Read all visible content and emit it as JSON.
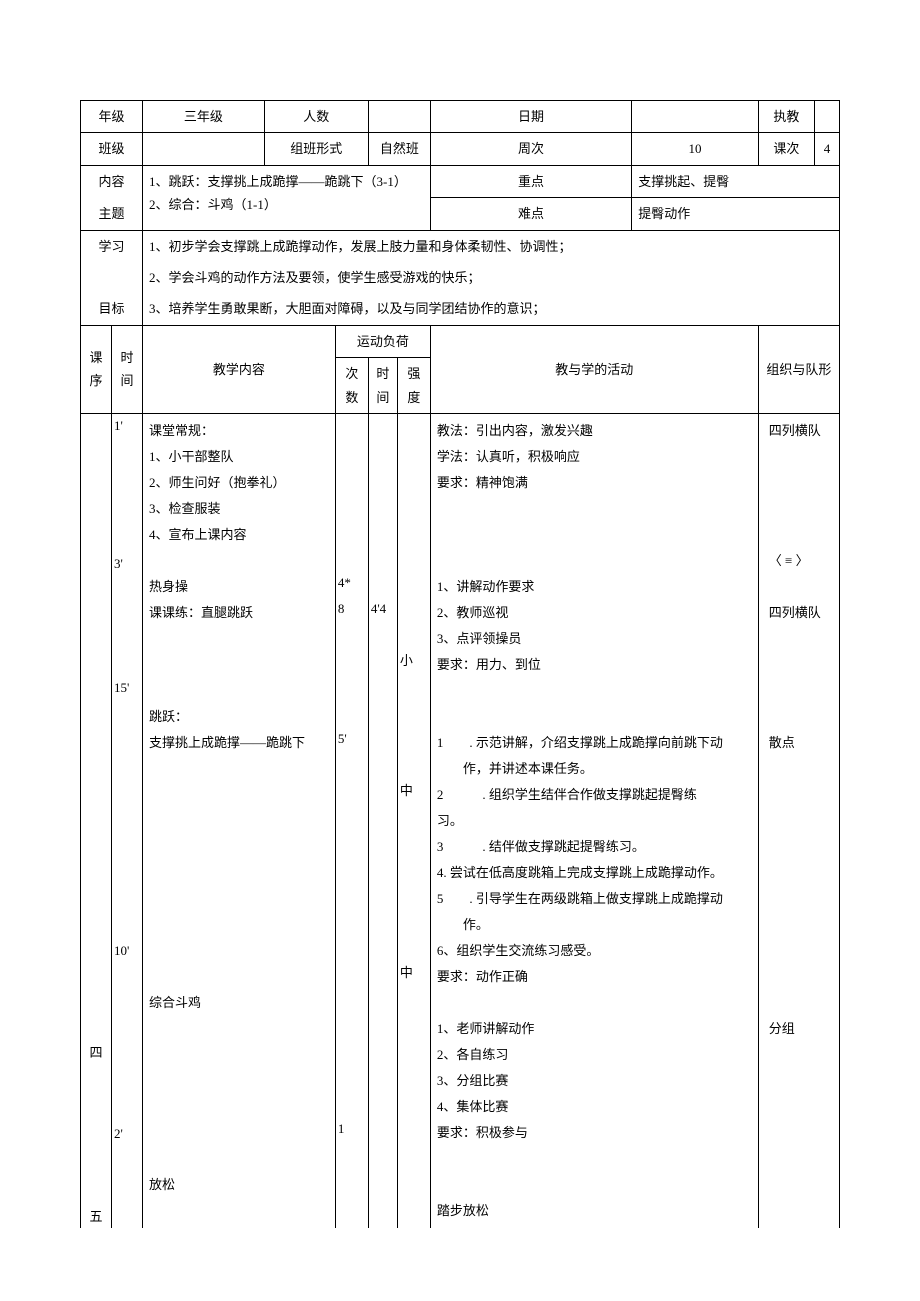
{
  "header": {
    "grade_label": "年级",
    "grade_value": "三年级",
    "headcount_label": "人数",
    "headcount_value": "",
    "date_label": "日期",
    "date_value": "",
    "teacher_label": "执教",
    "teacher_value": "",
    "class_label": "班级",
    "class_value": "",
    "classform_label": "组班形式",
    "classform_value": "自然班",
    "week_label": "周次",
    "week_value": "10",
    "lesson_label": "课次",
    "lesson_value": "4"
  },
  "content_theme": {
    "label_line1": "内容",
    "label_line2": "主题",
    "text_line1": "1、跳跃：支撑挑上成跪撑——跪跳下（3-1）",
    "text_line2": "2、综合：斗鸡（1-1）",
    "keypoint_label": "重点",
    "keypoint_value": "支撑挑起、提臀",
    "difficulty_label": "难点",
    "difficulty_value": "提臀动作"
  },
  "objectives": {
    "label_line1": "学习",
    "label_line2": "目标",
    "line1": "1、初步学会支撑跳上成跪撑动作，发展上肢力量和身体柔韧性、协调性；",
    "line2": "2、学会斗鸡的动作方法及要领，使学生感受游戏的快乐；",
    "line3": "3、培养学生勇敢果断，大胆面对障碍，以及与同学团结协作的意识；"
  },
  "tablehead": {
    "seq": "课序",
    "time": "时间",
    "teaching_content": "教学内容",
    "load": "运动负荷",
    "times": "次数",
    "duration": "时间",
    "intensity": "强度",
    "activity": "教与学的活动",
    "formation": "组织与队形"
  },
  "body": {
    "seq4": "四",
    "seq5": "五",
    "time1": "1'",
    "time3": "3'",
    "time15": "15'",
    "time10": "10'",
    "time2": "2'",
    "tc_block": "课堂常规：\n1、小干部整队\n2、师生问好（抱拳礼）\n3、检查服装\n4、宣布上课内容\n\n热身操\n课课练：直腿跳跃\n\n\n\n跳跃：\n支撑挑上成跪撑——跪跳下\n\n\n\n\n\n\n\n\n\n综合斗鸡\n\n\n\n\n\n\n放松",
    "times_col": "\n\n\n\n\n\n4*\n8\n\n\n\n\n5'\n\n\n\n\n\n\n\n\n\n\n\n\n\n\n1",
    "duration_col": "\n\n\n\n\n\n\n4'4",
    "intensity_col": "\n\n\n\n\n\n\n\n\n小\n\n\n\n\n中\n\n\n\n\n\n\n中",
    "activity_block": "教法：引出内容，激发兴趣\n学法：认真听，积极响应\n要求：精神饱满\n\n\n\n1、讲解动作要求\n2、教师巡视\n3、点评领操员\n要求：用力、到位\n\n\n1  . 示范讲解，介绍支撑跳上成跪撑向前跳下动\n  作，并讲述本课任务。\n2   . 组织学生结伴合作做支撑跳起提臀练\n习。\n3   . 结伴做支撑跳起提臀练习。\n4. 尝试在低高度跳箱上完成支撑跳上成跪撑动作。\n5  . 引导学生在两级跳箱上做支撑跳上成跪撑动\n  作。\n6、组织学生交流练习感受。\n要求：动作正确\n\n1、老师讲解动作\n2、各自练习\n3、分组比赛\n4、集体比赛\n要求：积极参与\n\n\n踏步放松",
    "formation_block": "四列横队\n\n\n\n\n〈 ≡ 〉\n\n四列横队\n\n\n\n\n散点\n\n\n\n\n\n\n\n\n\n\n分组"
  }
}
